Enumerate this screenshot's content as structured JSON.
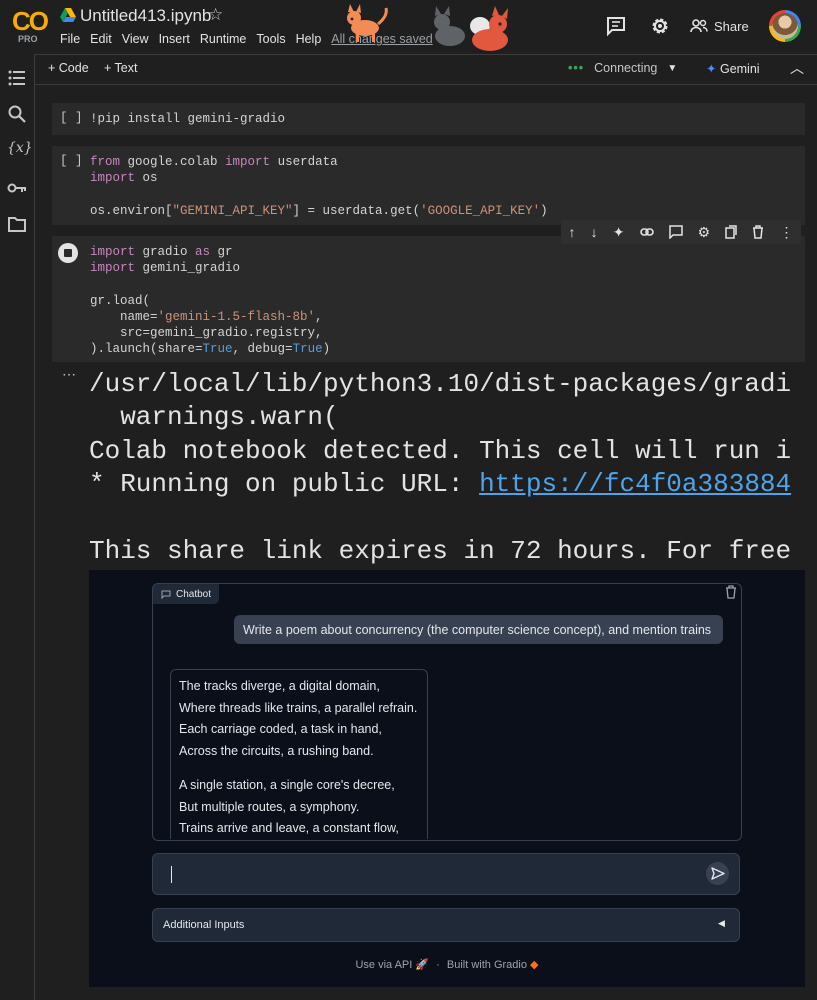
{
  "header": {
    "logo_text": "CO",
    "logo_badge": "PRO",
    "notebook_title": "Untitled413.ipynb",
    "menu": [
      "File",
      "Edit",
      "View",
      "Insert",
      "Runtime",
      "Tools",
      "Help"
    ],
    "save_status": "All changes saved",
    "share_label": "Share"
  },
  "toolbar": {
    "add_code": "+ Code",
    "add_text": "+ Text",
    "status": "Connecting",
    "gemini": "Gemini"
  },
  "cells": [
    {
      "bracket": "[ ]"
    },
    {
      "bracket": "[ ]"
    }
  ],
  "code": {
    "cell1": "!pip install gemini-gradio",
    "cell2_line1_kw1": "from",
    "cell2_line1_mod": " google.colab ",
    "cell2_line1_kw2": "import",
    "cell2_line1_name": " userdata",
    "cell2_line2_kw": "import",
    "cell2_line2_mod": " os",
    "cell2_line4_a": "os.environ[",
    "cell2_line4_str1": "\"GEMINI_API_KEY\"",
    "cell2_line4_b": "] = userdata.get(",
    "cell2_line4_str2": "'GOOGLE_API_KEY'",
    "cell2_line4_c": ")",
    "cell3_l1_kw1": "import",
    "cell3_l1_a": " gradio ",
    "cell3_l1_kw2": "as",
    "cell3_l1_b": " gr",
    "cell3_l2_kw": "import",
    "cell3_l2_a": " gemini_gradio",
    "cell3_l4": "gr.load(",
    "cell3_l5_a": "    name=",
    "cell3_l5_str": "'gemini-1.5-flash-8b'",
    "cell3_l5_b": ",",
    "cell3_l6": "    src=gemini_gradio.registry,",
    "cell3_l7_a": ").launch(share=",
    "cell3_l7_t1": "True",
    "cell3_l7_b": ", debug=",
    "cell3_l7_t2": "True",
    "cell3_l7_c": ")"
  },
  "output": {
    "line1": "/usr/local/lib/python3.10/dist-packages/gradi",
    "line2": "  warnings.warn(",
    "line3": "Colab notebook detected. This cell will run i",
    "line4_prefix": "* Running on public URL: ",
    "line4_link": "https://fc4f0a383884",
    "line6": "This share link expires in 72 hours. For free"
  },
  "gradio": {
    "chatbot_label": "Chatbot",
    "user_message": "Write a poem about concurrency (the computer science concept), and mention trains",
    "bot_stanza1": [
      "The tracks diverge, a digital domain,",
      "Where threads like trains, a parallel refrain.",
      "Each carriage coded, a task in hand,",
      "Across the circuits, a rushing band."
    ],
    "bot_stanza2": [
      "A single station, a single core's decree,",
      "But multiple routes, a symphony.",
      "Trains arrive and leave, a constant flow,"
    ],
    "additional_inputs": "Additional Inputs",
    "footer_api": "Use via API",
    "footer_sep": "·",
    "footer_built": "Built with Gradio"
  }
}
